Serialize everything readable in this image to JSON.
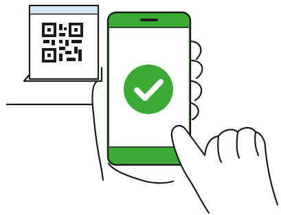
{
  "illustration": {
    "subject": "qr-code-scan-success",
    "icons": [
      "qr-code-icon",
      "smartphone-icon",
      "check-icon",
      "hand-icon",
      "laptop-icon"
    ],
    "colors": {
      "accent_green": "#3aaa35",
      "screen_top_bar": "#cfe6f3",
      "outline": "#1a1a1a",
      "background": "#ffffff"
    },
    "status": {
      "scan_complete": true
    }
  }
}
